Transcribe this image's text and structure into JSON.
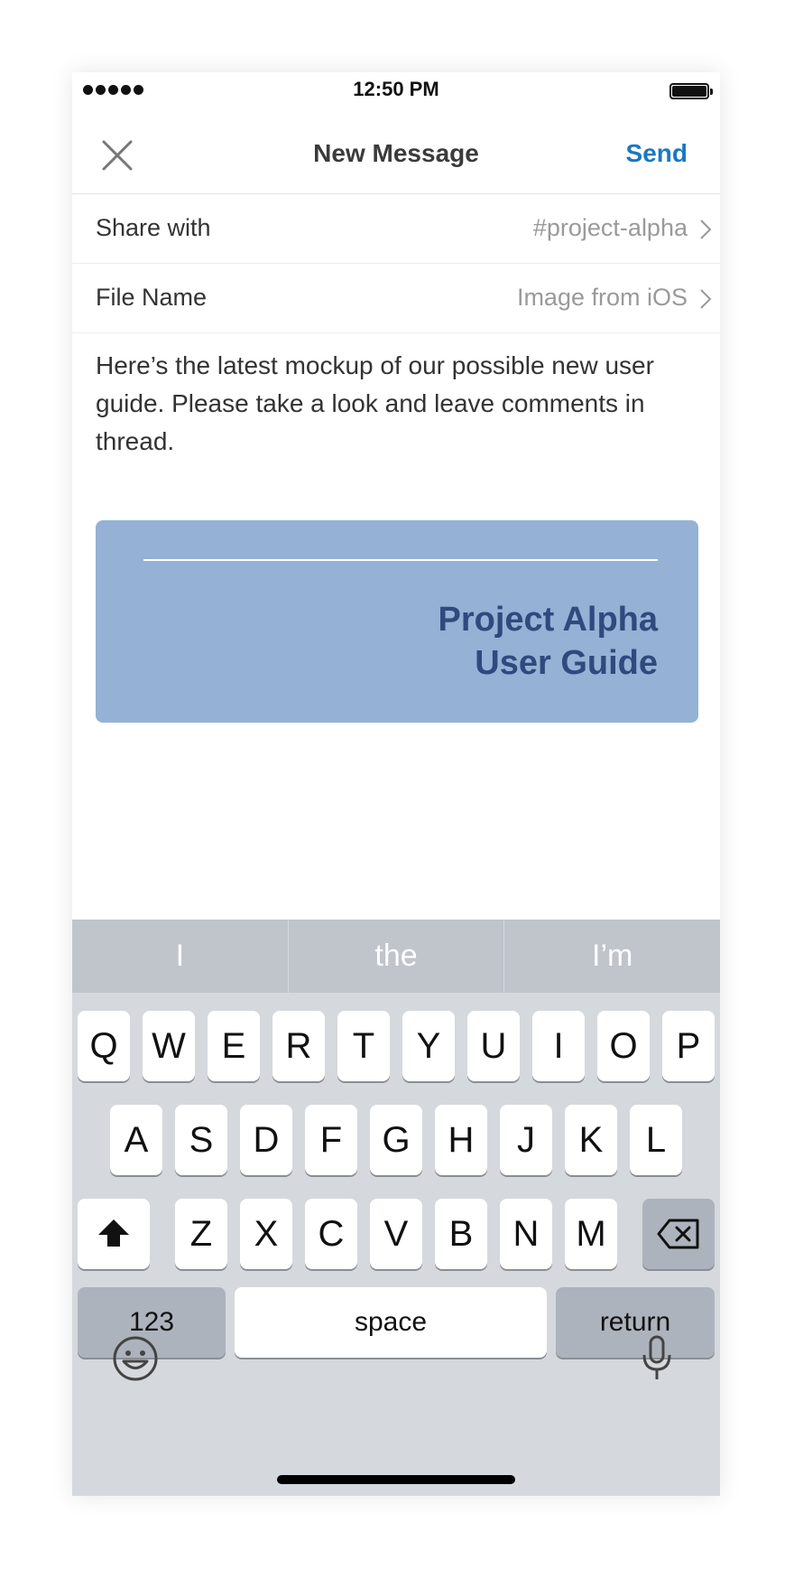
{
  "status": {
    "time": "12:50 PM"
  },
  "nav": {
    "title": "New Message",
    "send": "Send"
  },
  "share_with": {
    "label": "Share with",
    "value": "#project-alpha"
  },
  "file_name": {
    "label": "File Name",
    "value": "Image from iOS"
  },
  "message": "Here’s the latest mockup of our possible new user guide. Please take a look and leave comments in thread.",
  "attachment": {
    "line1": "Project Alpha",
    "line2": "User Guide",
    "background": "#95b1d6",
    "text_color": "#2f4a7d"
  },
  "suggestions": [
    "I",
    "the",
    "I’m"
  ],
  "keyboard": {
    "row1": [
      "Q",
      "W",
      "E",
      "R",
      "T",
      "Y",
      "U",
      "I",
      "O",
      "P"
    ],
    "row2": [
      "A",
      "S",
      "D",
      "F",
      "G",
      "H",
      "J",
      "K",
      "L"
    ],
    "row3": [
      "Z",
      "X",
      "C",
      "V",
      "B",
      "N",
      "M"
    ],
    "numbers": "123",
    "space": "space",
    "return": "return"
  },
  "colors": {
    "accent": "#1a78c2",
    "keyboard_bg": "#d5d8dd"
  },
  "icons": [
    "signal-dots-icon",
    "battery-icon",
    "close-icon",
    "chevron-right-icon",
    "shift-icon",
    "backspace-icon",
    "emoji-icon",
    "microphone-icon"
  ]
}
